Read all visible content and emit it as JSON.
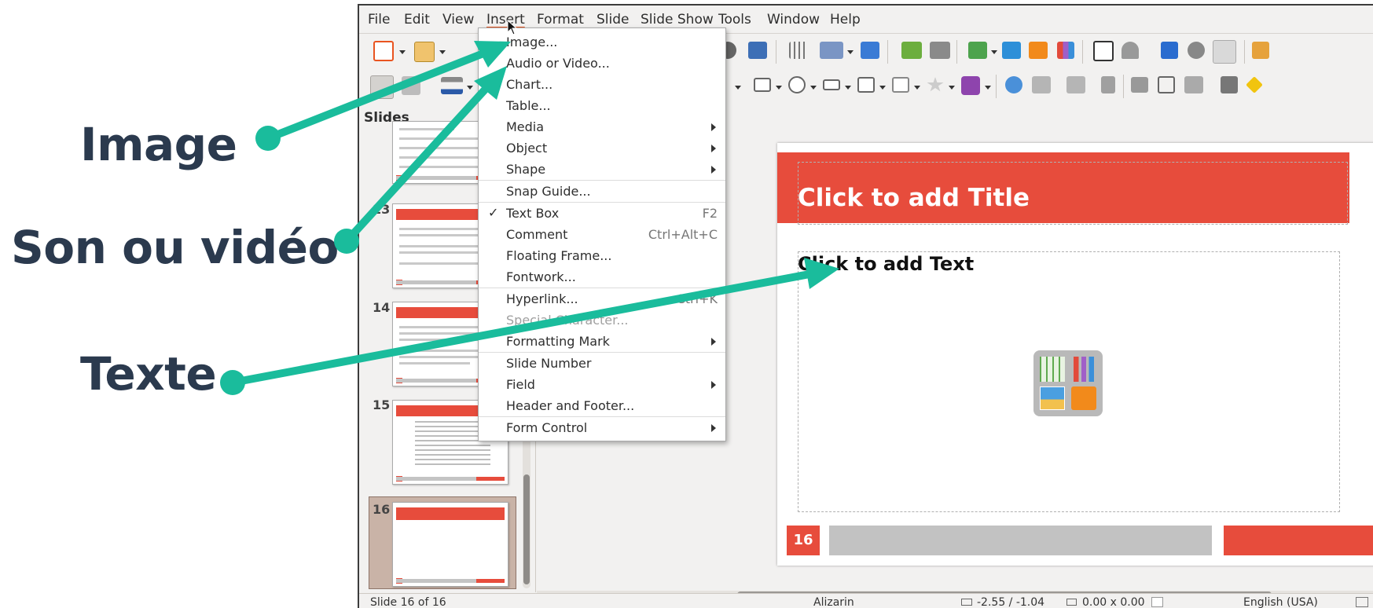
{
  "annotations": {
    "image": "Image",
    "audio_video": "Son ou vidéo",
    "text": "Texte"
  },
  "colors": {
    "accent_red": "#e74c3c",
    "arrow_green": "#1abc9c",
    "label_navy": "#2b3a4e"
  },
  "menubar": {
    "file": "File",
    "edit": "Edit",
    "view": "View",
    "insert": "Insert",
    "format": "Format",
    "slide": "Slide",
    "slide_show": "Slide Show",
    "tools": "Tools",
    "window": "Window",
    "help": "Help"
  },
  "insert_menu": {
    "image": "Image...",
    "audio_video": "Audio or Video...",
    "chart": "Chart...",
    "table": "Table...",
    "media": "Media",
    "object": "Object",
    "shape": "Shape",
    "snap_guide": "Snap Guide...",
    "text_box": "Text Box",
    "text_box_shortcut": "F2",
    "comment": "Comment",
    "comment_shortcut": "Ctrl+Alt+C",
    "floating_frame": "Floating Frame...",
    "fontwork": "Fontwork...",
    "hyperlink": "Hyperlink...",
    "hyperlink_shortcut": "Ctrl+K",
    "special_character": "Special Character...",
    "formatting_mark": "Formatting Mark",
    "slide_number": "Slide Number",
    "field": "Field",
    "header_footer": "Header and Footer...",
    "form_control": "Form Control"
  },
  "slides_panel": {
    "title": "Slides",
    "numbers": [
      "13",
      "14",
      "15",
      "16"
    ]
  },
  "slide": {
    "title_placeholder": "Click to add Title",
    "text_placeholder": "Click to add Text",
    "number": "16"
  },
  "statusbar": {
    "slide_count": "Slide 16 of 16",
    "theme": "Alizarin",
    "position": "-2.55 / -1.04",
    "size": "0.00 x 0.00",
    "language": "English (USA)"
  }
}
